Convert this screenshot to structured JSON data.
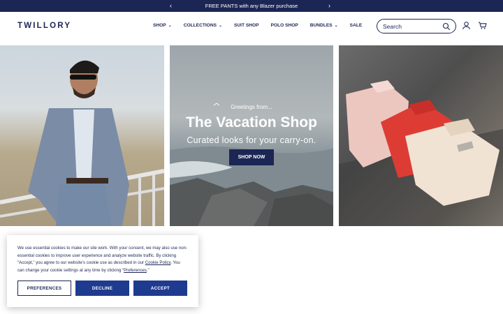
{
  "announcement": {
    "text": "FREE PANTS with any Blazer purchase",
    "prev": "‹",
    "next": "›"
  },
  "header": {
    "logo": "TWILLORY",
    "nav": [
      {
        "label": "SHOP",
        "chevron": "⌄"
      },
      {
        "label": "COLLECTIONS",
        "chevron": "⌄"
      },
      {
        "label": "SUIT SHOP"
      },
      {
        "label": "POLO SHOP"
      },
      {
        "label": "BUNDLES",
        "chevron": "⌄"
      },
      {
        "label": "SALE"
      }
    ],
    "search_placeholder": "Search",
    "icons": [
      "search-icon",
      "account-icon",
      "cart-icon"
    ]
  },
  "hero": {
    "pre": "Greetings from...",
    "title": "The Vacation Shop",
    "subtitle": "Curated looks for your carry-on.",
    "button": "SHOP NOW"
  },
  "cookie": {
    "text_1": "We use essential cookies to make our site work. With your consent, we may also use non-essential cookies to improve user experience and analyze website traffic. By clicking “Accept,” you agree to our website's cookie use as described in our ",
    "policy_link": "Cookie Policy",
    "text_2": ". You can change your cookie settings at any time by clicking “",
    "pref_link": "Preferences",
    "text_3": ".”",
    "buttons": {
      "preferences": "PREFERENCES",
      "decline": "DECLINE",
      "accept": "ACCEPT"
    }
  },
  "colors": {
    "navy": "#1b2654",
    "button_blue": "#1f3b8f",
    "white": "#ffffff"
  }
}
